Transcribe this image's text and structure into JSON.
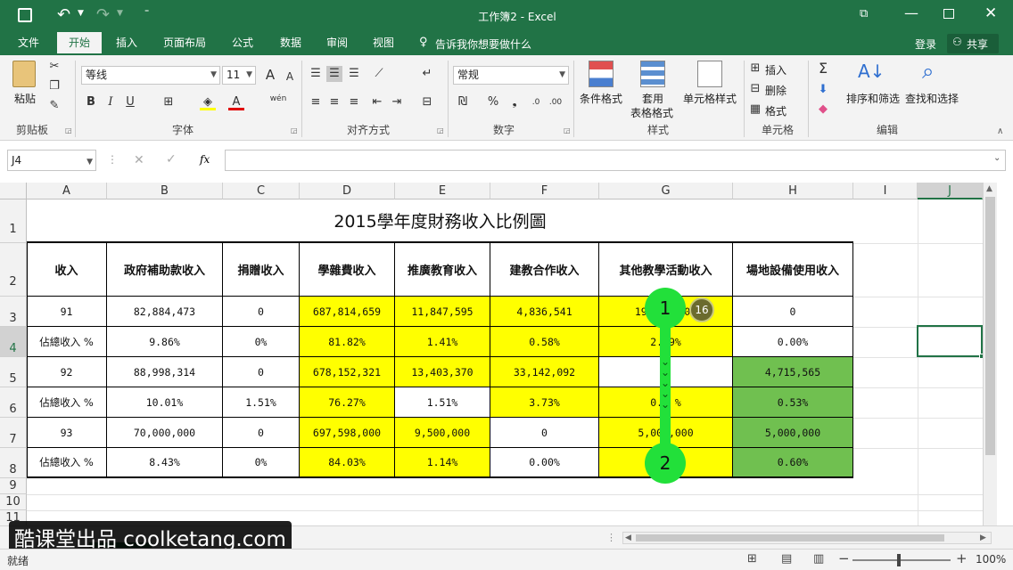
{
  "window": {
    "title": "工作簿2 - Excel"
  },
  "tabs": [
    "文件",
    "开始",
    "插入",
    "页面布局",
    "公式",
    "数据",
    "审阅",
    "视图"
  ],
  "tell_me": "告诉我你想要做什么",
  "account": {
    "login": "登录",
    "share": "共享"
  },
  "ribbon": {
    "clipboard": {
      "paste": "粘贴",
      "group": "剪贴板"
    },
    "font": {
      "name": "等线",
      "size": "11",
      "group": "字体",
      "grow": "A",
      "shrink": "A",
      "bold": "B",
      "italic": "I",
      "underline": "U",
      "color_letter": "A",
      "phonetic": "wén"
    },
    "alignment": {
      "group": "对齐方式"
    },
    "number": {
      "format": "常规",
      "group": "数字",
      "percent": "%"
    },
    "styles": {
      "conditional": "条件格式",
      "table1": "套用",
      "table2": "表格格式",
      "cell": "单元格样式",
      "group": "样式"
    },
    "cells": {
      "insert": "插入",
      "delete": "删除",
      "format": "格式",
      "group": "单元格"
    },
    "editing": {
      "sort": "排序和筛选",
      "find": "查找和选择",
      "group": "编辑"
    }
  },
  "formula_bar": {
    "name_box": "J4",
    "fx": "fx",
    "value": ""
  },
  "columns": [
    "A",
    "B",
    "C",
    "D",
    "E",
    "F",
    "G",
    "H",
    "I",
    "J"
  ],
  "rows": [
    "1",
    "2",
    "3",
    "4",
    "5",
    "6",
    "7",
    "8",
    "9",
    "10",
    "11"
  ],
  "sheet": {
    "title": "2015學年度財務收入比例圖",
    "headers": [
      "收入",
      "政府補助款收入",
      "捐贈收入",
      "學雜費收入",
      "推廣教育收入",
      "建教合作收入",
      "其他教學活動收入",
      "場地設備使用收入"
    ],
    "row3": [
      "91",
      "82,884,473",
      "0",
      "687,814,659",
      "11,847,595",
      "4,836,541",
      "19,2  ,108",
      "0"
    ],
    "row4": [
      "佔總收入 %",
      "9.86%",
      "0%",
      "81.82%",
      "1.41%",
      "0.58%",
      "2.29%",
      "0.00%"
    ],
    "row5": [
      "92",
      "88,998,314",
      "0",
      "678,152,321",
      "13,403,370",
      "33,142,092",
      "",
      "4,715,565"
    ],
    "row6": [
      "佔總收入 %",
      "10.01%",
      "1.51%",
      "76.27%",
      "1.51%",
      "3.73%",
      "0.  %",
      "0.53%"
    ],
    "row7": [
      "93",
      "70,000,000",
      "0",
      "697,598,000",
      "9,500,000",
      "0",
      "5,000,000",
      "5,000,000"
    ],
    "row8": [
      "佔總收入 %",
      "8.43%",
      "0%",
      "84.03%",
      "1.14%",
      "0.00%",
      "0.  %",
      "0.60%"
    ]
  },
  "annotations": {
    "start": "1",
    "end": "2",
    "count": "16",
    "arrows": "⌄⌄⌄⌄⌄"
  },
  "watermark": "酷课堂出品 coolketang.com",
  "status": {
    "ready": "就绪",
    "zoom": "100%"
  },
  "colors": {
    "excel_green": "#217346",
    "highlight_yellow": "#ffff00",
    "highlight_green": "#70c050",
    "annotation_green": "#22e03a"
  }
}
